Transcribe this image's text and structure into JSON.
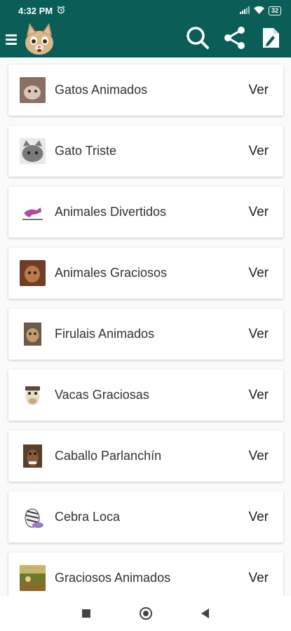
{
  "status_bar": {
    "time": "4:32 PM",
    "battery": "32"
  },
  "app_bar": {
    "menu_icon": "hamburger-menu-icon",
    "logo_icon": "cat-logo-icon",
    "actions": [
      "search-icon",
      "share-icon",
      "edit-note-icon"
    ]
  },
  "items": [
    {
      "title": "Gatos Animados",
      "action": "Ver",
      "thumb_color": "#8a6f63"
    },
    {
      "title": "Gato Triste",
      "action": "Ver",
      "thumb_color": "#7a7a7a"
    },
    {
      "title": "Animales Divertidos",
      "action": "Ver",
      "thumb_color": "#b04aa0"
    },
    {
      "title": "Animales Graciosos",
      "action": "Ver",
      "thumb_color": "#6e3f24"
    },
    {
      "title": "Firulais Animados",
      "action": "Ver",
      "thumb_color": "#6b5a48"
    },
    {
      "title": "Vacas Graciosas",
      "action": "Ver",
      "thumb_color": "#5b4a3a"
    },
    {
      "title": "Caballo Parlanchín",
      "action": "Ver",
      "thumb_color": "#5c3d2a"
    },
    {
      "title": "Cebra Loca",
      "action": "Ver",
      "thumb_color": "#3a3a3a"
    },
    {
      "title": "Graciosos Animados",
      "action": "Ver",
      "thumb_color": "#6b7a2e"
    }
  ],
  "colors": {
    "primary": "#0b5e57",
    "card_bg": "#ffffff",
    "list_bg": "#fafafa"
  },
  "nav_bar": {
    "buttons": [
      "recents-square-icon",
      "home-circle-icon",
      "back-triangle-icon"
    ]
  }
}
